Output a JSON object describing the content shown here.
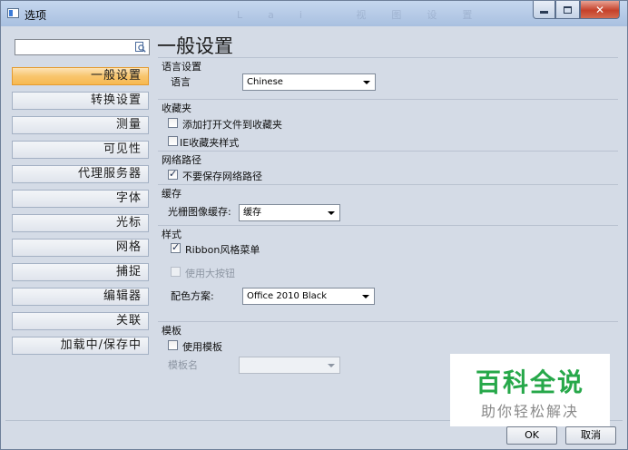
{
  "window": {
    "title": "选项",
    "titlebar_ghost": "Lai 视图设置 位置 时间 功能"
  },
  "search": {
    "value": "",
    "placeholder": ""
  },
  "nav": {
    "items": [
      {
        "label": "一般设置",
        "active": true
      },
      {
        "label": "转换设置"
      },
      {
        "label": "测量"
      },
      {
        "label": "可见性"
      },
      {
        "label": "代理服务器"
      },
      {
        "label": "字体"
      },
      {
        "label": "光标"
      },
      {
        "label": "网格"
      },
      {
        "label": "捕捉"
      },
      {
        "label": "编辑器"
      },
      {
        "label": "关联"
      },
      {
        "label": "加载中/保存中"
      }
    ]
  },
  "page": {
    "title": "一般设置",
    "language": {
      "group": "语言设置",
      "label": "语言",
      "value": "Chinese"
    },
    "favorites": {
      "group": "收藏夹",
      "add_to_favorites": {
        "label": "添加打开文件到收藏夹",
        "checked": false
      },
      "ie_style": {
        "label": "IE收藏夹样式",
        "checked": false
      }
    },
    "network": {
      "group": "网络路径",
      "dont_save": {
        "label": "不要保存网络路径",
        "checked": true
      }
    },
    "cache": {
      "group": "缓存",
      "label": "光栅图像缓存:",
      "value": "缓存"
    },
    "style": {
      "group": "样式",
      "ribbon": {
        "label": "Ribbon风格菜单",
        "checked": true
      },
      "large_buttons": {
        "label": "使用大按钮",
        "checked": false,
        "disabled": true
      },
      "color_scheme": {
        "label": "配色方案:",
        "value": "Office 2010 Black"
      }
    },
    "template": {
      "group": "模板",
      "use_template": {
        "label": "使用模板",
        "checked": false
      },
      "name_label": "模板名",
      "name_value": ""
    }
  },
  "buttons": {
    "ok": "OK",
    "cancel": "取消"
  },
  "watermark": {
    "main": "百科全说",
    "sub": "助你轻松解决"
  },
  "colors": {
    "active_nav": "#f8c56e",
    "close_button": "#c5412a",
    "watermark": "#27a84a"
  }
}
